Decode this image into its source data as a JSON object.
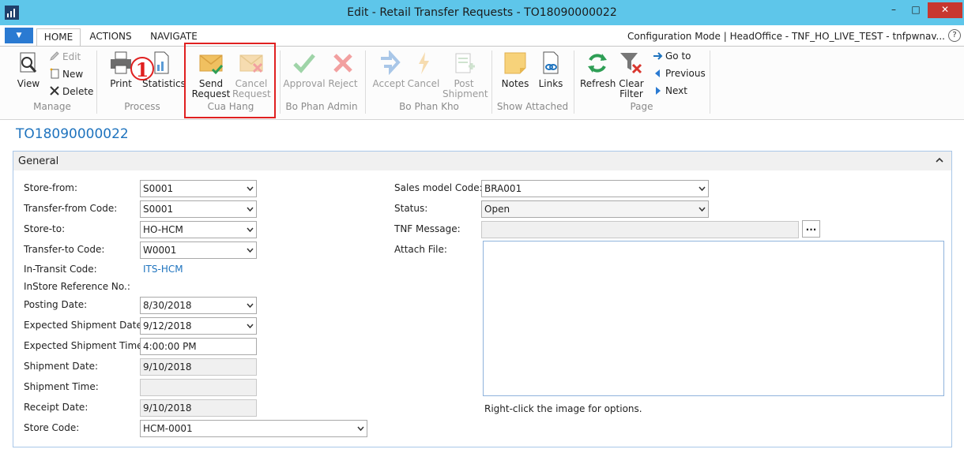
{
  "window": {
    "title": "Edit - Retail Transfer Requests - TO18090000022",
    "app_icon": "dynamics-nav-icon",
    "minimize": "–",
    "maximize": "□",
    "close": "✕"
  },
  "tabs": {
    "home": "HOME",
    "actions": "ACTIONS",
    "navigate": "NAVIGATE"
  },
  "config_text": "Configuration Mode | HeadOffice - TNF_HO_LIVE_TEST - tnfpwnav...",
  "help": "?",
  "ribbon": {
    "view": "View",
    "edit": "Edit",
    "new": "New",
    "delete": "Delete",
    "manage_group": "Manage",
    "print": "Print",
    "statistics": "Statistics",
    "process_group": "Process",
    "send_request_1": "Send",
    "send_request_2": "Request",
    "cancel_request_1": "Cancel",
    "cancel_request_2": "Request",
    "cua_hang_group": "Cua Hang",
    "approval": "Approval",
    "reject": "Reject",
    "bo_phan_admin_group": "Bo Phan Admin",
    "accept": "Accept",
    "cancel": "Cancel",
    "post_shipment_1": "Post",
    "post_shipment_2": "Shipment",
    "bo_phan_kho_group": "Bo Phan Kho",
    "notes": "Notes",
    "links": "Links",
    "show_attached_group": "Show Attached",
    "refresh": "Refresh",
    "clear_filter_1": "Clear",
    "clear_filter_2": "Filter",
    "go_to": "Go to",
    "previous": "Previous",
    "next": "Next",
    "page_group": "Page"
  },
  "callout": "1",
  "record_title": "TO18090000022",
  "fasttab": {
    "title": "General",
    "collapse": "⌃"
  },
  "fields_left": [
    {
      "label": "Store-from:",
      "value": "S0001"
    },
    {
      "label": "Transfer-from Code:",
      "value": "S0001"
    },
    {
      "label": "Store-to:",
      "value": "HO-HCM"
    },
    {
      "label": "Transfer-to Code:",
      "value": "W0001"
    },
    {
      "label": "In-Transit Code:",
      "value": "ITS-HCM"
    },
    {
      "label": "InStore Reference No.:",
      "value": ""
    },
    {
      "label": "Posting Date:",
      "value": "8/30/2018"
    },
    {
      "label": "Expected Shipment Date:",
      "value": "9/12/2018"
    },
    {
      "label": "Expected Shipment Time:",
      "value": "4:00:00 PM"
    },
    {
      "label": "Shipment Date:",
      "value": "9/10/2018"
    },
    {
      "label": "Shipment Time:",
      "value": ""
    },
    {
      "label": "Receipt Date:",
      "value": "9/10/2018"
    },
    {
      "label": "Store Code:",
      "value": "HCM-0001"
    }
  ],
  "fields_right": [
    {
      "label": "Sales model Code:",
      "value": "BRA001"
    },
    {
      "label": "Status:",
      "value": "Open"
    },
    {
      "label": "TNF Message:",
      "value": ""
    },
    {
      "label": "Attach File:",
      "value": ""
    }
  ],
  "ellipsis": "...",
  "attach_hint": "Right-click the image for options."
}
